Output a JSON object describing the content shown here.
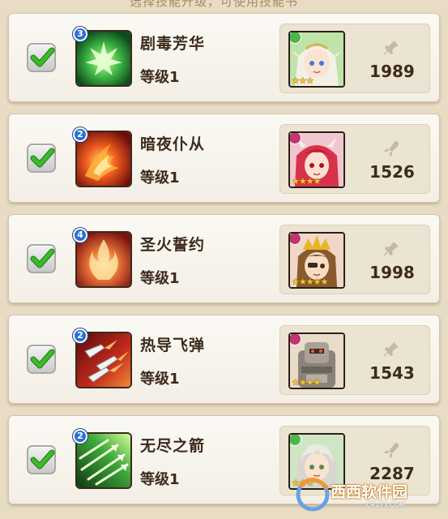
{
  "top_partial_text": "选择技能升级，可使用技能书",
  "skills": [
    {
      "name": "剧毒芳华",
      "level": "等级1",
      "tier": "3",
      "power": "1989",
      "element": "green",
      "icon": "leaf-burst-icon",
      "checked": true,
      "stars": "★★★"
    },
    {
      "name": "暗夜仆从",
      "level": "等级1",
      "tier": "2",
      "power": "1526",
      "element": "pink",
      "icon": "fire-wing-icon",
      "checked": true,
      "stars": "★★★★"
    },
    {
      "name": "圣火誓约",
      "level": "等级1",
      "tier": "4",
      "power": "1998",
      "element": "pink",
      "icon": "holy-fire-icon",
      "checked": true,
      "stars": "★★★★★"
    },
    {
      "name": "热导飞弹",
      "level": "等级1",
      "tier": "2",
      "power": "1543",
      "element": "pink",
      "icon": "missile-icon",
      "checked": true,
      "stars": "★★★★"
    },
    {
      "name": "无尽之箭",
      "level": "等级1",
      "tier": "2",
      "power": "2287",
      "element": "green",
      "icon": "arrow-volley-icon",
      "checked": true,
      "stars": "★★★"
    }
  ],
  "watermark": {
    "text": "西西软件园",
    "site": "CR173.COM"
  },
  "colors": {
    "background": "#e9dcc4",
    "check": "#3cbb2a",
    "tier_badge": "#2d6fd2",
    "green_element": "#4fb54a",
    "pink_element": "#c2356f"
  }
}
